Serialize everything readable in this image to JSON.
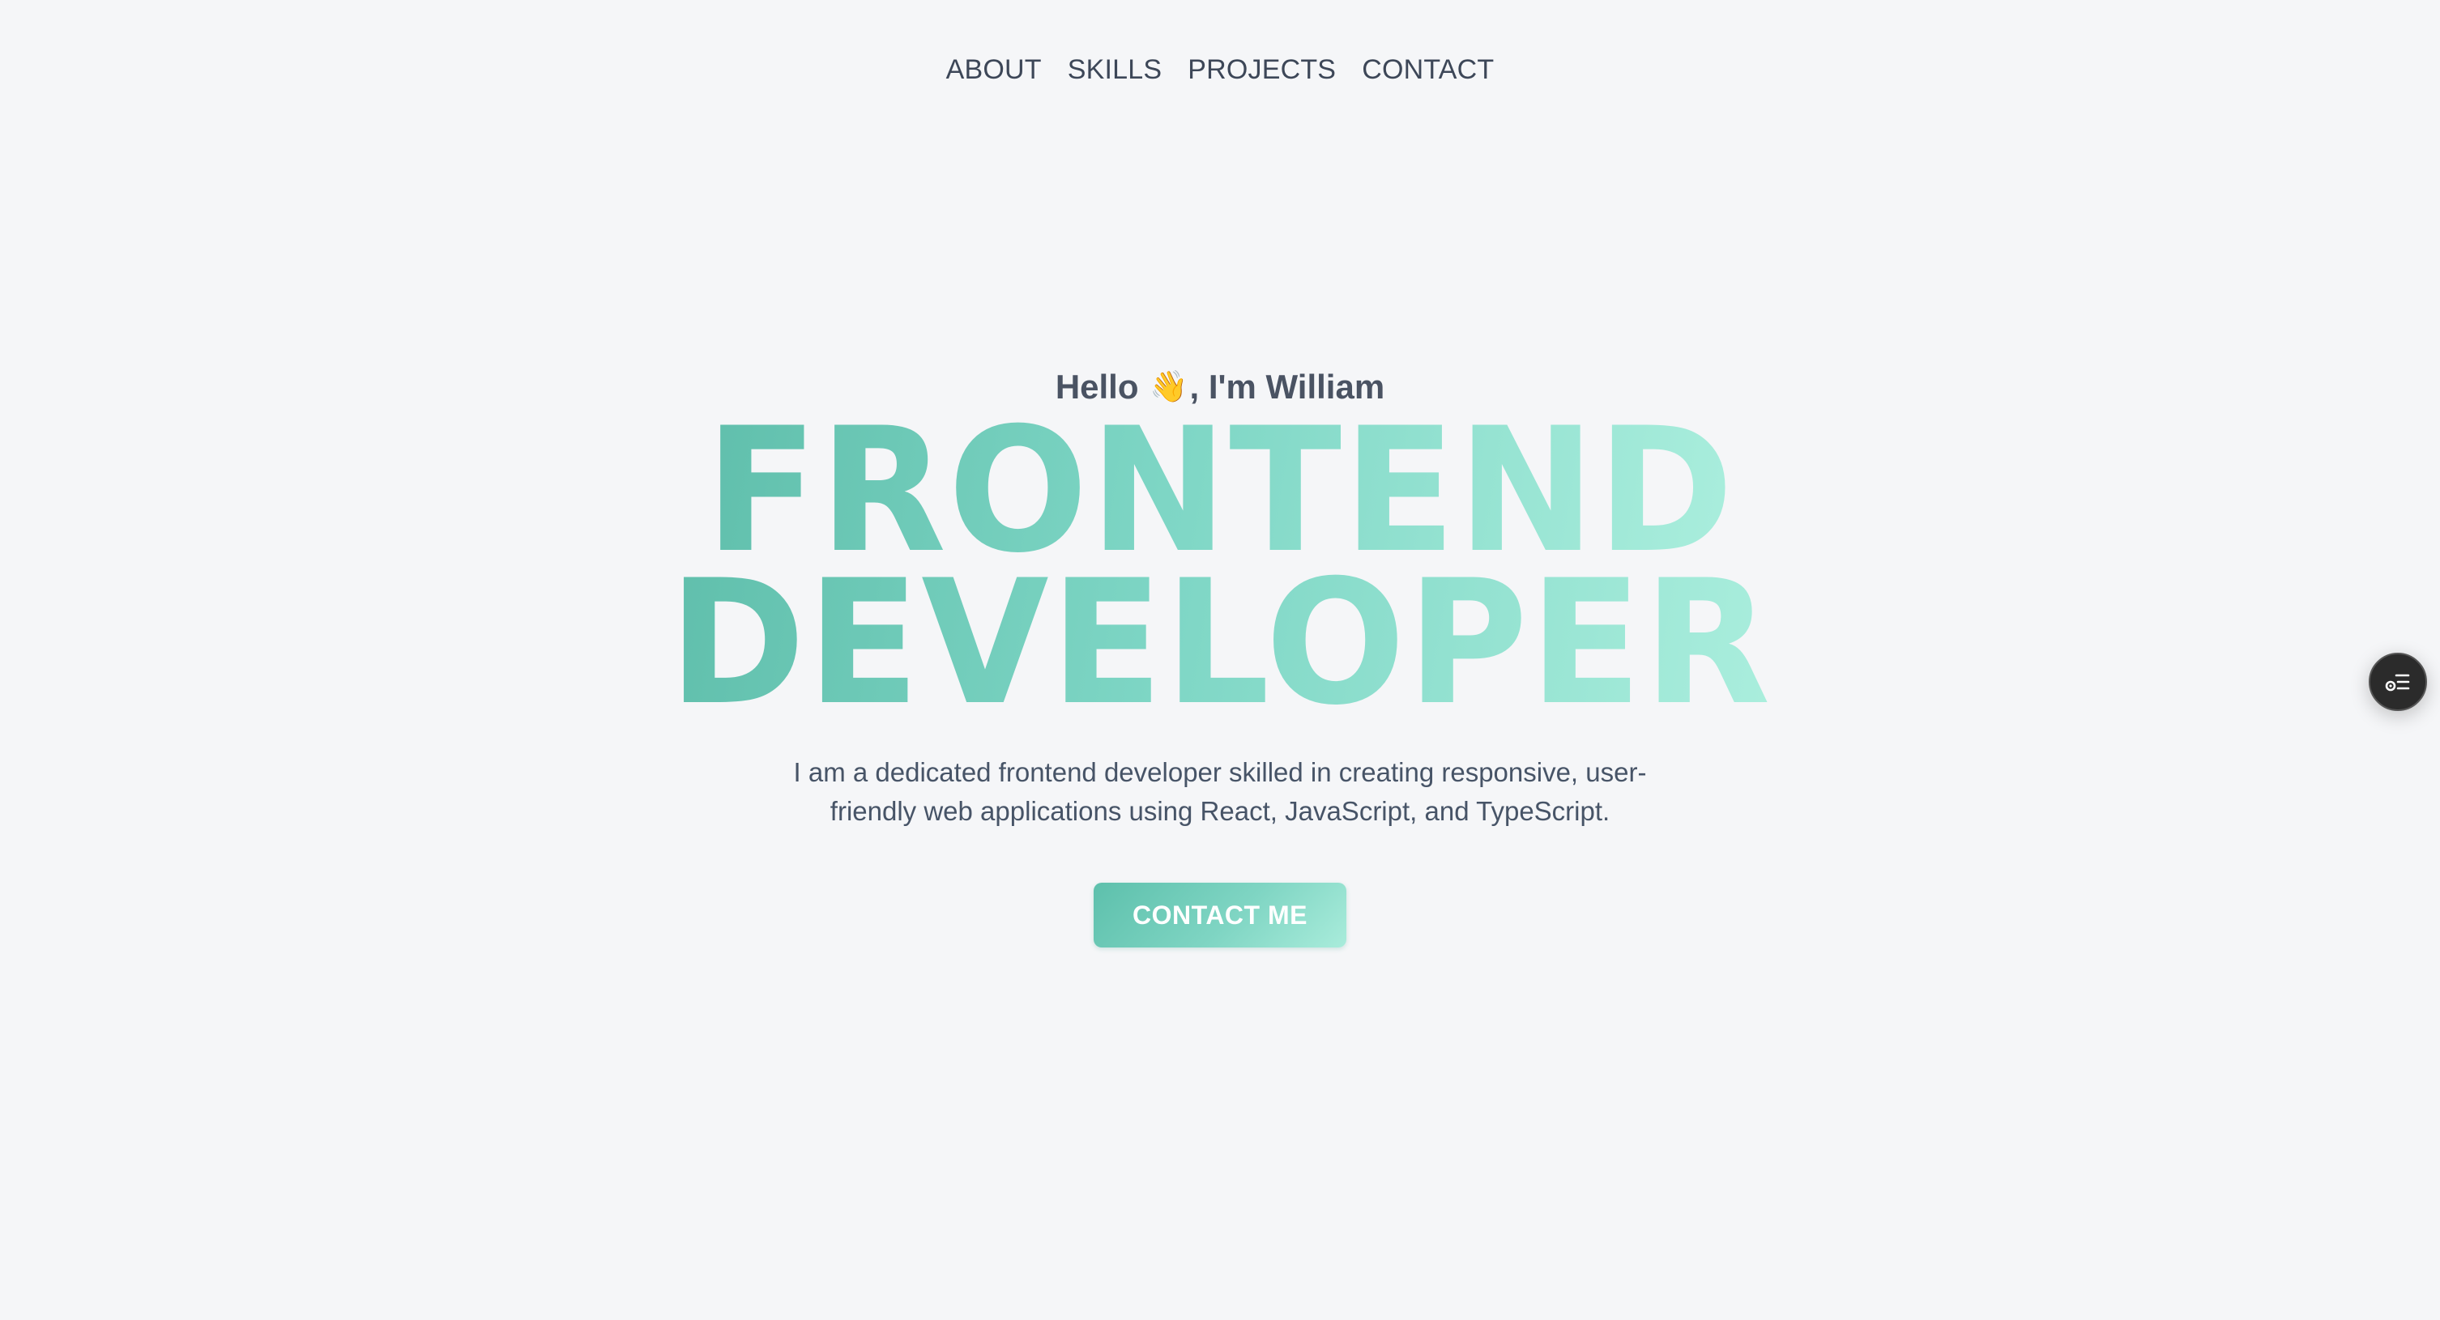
{
  "nav": {
    "items": [
      {
        "label": "ABOUT"
      },
      {
        "label": "SKILLS"
      },
      {
        "label": "PROJECTS"
      },
      {
        "label": "CONTACT"
      }
    ]
  },
  "hero": {
    "greeting_prefix": "Hello ",
    "greeting_icon": "waving-hand-icon",
    "greeting_emoji": "👋",
    "greeting_suffix": ", I'm William",
    "headline_line1": "FRONTEND",
    "headline_line2": "DEVELOPER",
    "description": "I am a dedicated frontend developer skilled in creating responsive, user-friendly web applications using React, JavaScript, and TypeScript.",
    "cta_label": "CONTACT ME"
  },
  "widget": {
    "icon": "list-settings-icon"
  },
  "colors": {
    "background": "#f5f6f8",
    "accent_start": "#5dc0ac",
    "accent_end": "#a9ecdb",
    "text": "#475467",
    "widget_bg": "#2b2b2b"
  }
}
